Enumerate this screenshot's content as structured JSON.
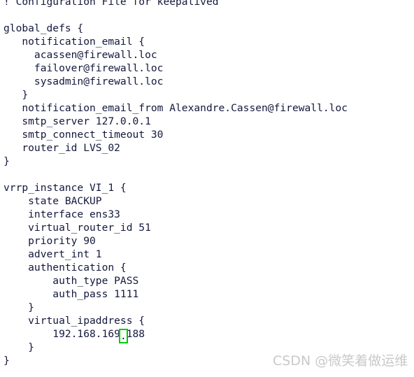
{
  "document": {
    "kind": "keepalived-config-file",
    "colors": {
      "background": "#ffffff",
      "text": "#14183c",
      "cursor_outline": "#00cc00",
      "watermark": "#c9c9c9"
    },
    "lines": [
      {
        "id": "l01",
        "text": "! Configuration File for keepalived"
      },
      {
        "id": "l02",
        "text": ""
      },
      {
        "id": "l03",
        "text": "global_defs {"
      },
      {
        "id": "l04",
        "text": "   notification_email {"
      },
      {
        "id": "l05",
        "text": "     acassen@firewall.loc"
      },
      {
        "id": "l06",
        "text": "     failover@firewall.loc"
      },
      {
        "id": "l07",
        "text": "     sysadmin@firewall.loc"
      },
      {
        "id": "l08",
        "text": "   }"
      },
      {
        "id": "l09",
        "text": "   notification_email_from Alexandre.Cassen@firewall.loc"
      },
      {
        "id": "l10",
        "text": "   smtp_server 127.0.0.1"
      },
      {
        "id": "l11",
        "text": "   smtp_connect_timeout 30"
      },
      {
        "id": "l12",
        "text": "   router_id LVS_02"
      },
      {
        "id": "l13",
        "text": "}"
      },
      {
        "id": "l14",
        "text": ""
      },
      {
        "id": "l15",
        "text": "vrrp_instance VI_1 {"
      },
      {
        "id": "l16",
        "text": "    state BACKUP"
      },
      {
        "id": "l17",
        "text": "    interface ens33"
      },
      {
        "id": "l18",
        "text": "    virtual_router_id 51"
      },
      {
        "id": "l19",
        "text": "    priority 90"
      },
      {
        "id": "l20",
        "text": "    advert_int 1"
      },
      {
        "id": "l21",
        "text": "    authentication {"
      },
      {
        "id": "l22",
        "text": "        auth_type PASS"
      },
      {
        "id": "l23",
        "text": "        auth_pass 1111"
      },
      {
        "id": "l24",
        "text": "    }"
      },
      {
        "id": "l25",
        "text": "    virtual_ipaddress {"
      },
      {
        "id": "l26",
        "before": "        192.168.169",
        "cursor": ".",
        "after": "188"
      },
      {
        "id": "l27",
        "text": "    }"
      },
      {
        "id": "l28",
        "text": "}"
      }
    ]
  },
  "watermark": {
    "text": "CSDN @微笑着做运维"
  }
}
